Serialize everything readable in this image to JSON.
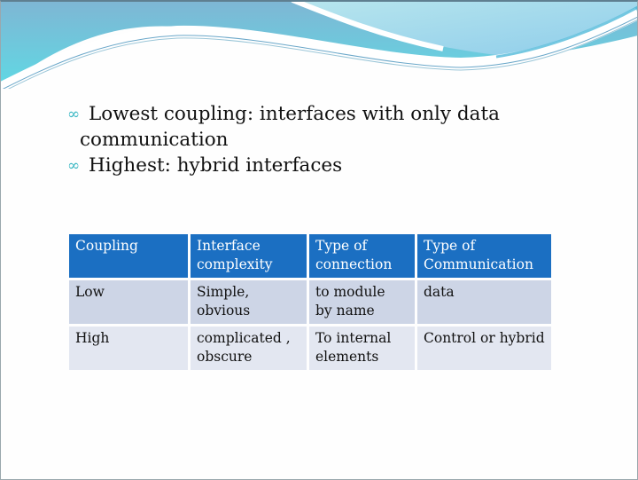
{
  "slide": {
    "bullets": [
      {
        "icon": "scroll-swirl-icon",
        "line1": "Lowest coupling: interfaces with only data",
        "line2": "communication"
      },
      {
        "icon": "scroll-swirl-icon",
        "line1": "Highest: hybrid interfaces"
      }
    ],
    "table": {
      "headers": [
        [
          "Coupling"
        ],
        [
          "Interface",
          "complexity"
        ],
        [
          "Type of",
          "connection"
        ],
        [
          "Type of",
          "Communication"
        ]
      ],
      "rows": [
        [
          [
            "Low"
          ],
          [
            "Simple,",
            "obvious"
          ],
          [
            "to module",
            "by name"
          ],
          [
            "data"
          ]
        ],
        [
          [
            "High"
          ],
          [
            "complicated ,",
            "obscure"
          ],
          [
            "To internal",
            "elements"
          ],
          [
            "Control or hybrid"
          ]
        ]
      ]
    },
    "colors": {
      "header_bg": "#1b6fc2",
      "row_odd_bg": "#cdd5e6",
      "row_even_bg": "#e3e7f1",
      "bullet_glyph": "#3cb8c4"
    }
  }
}
